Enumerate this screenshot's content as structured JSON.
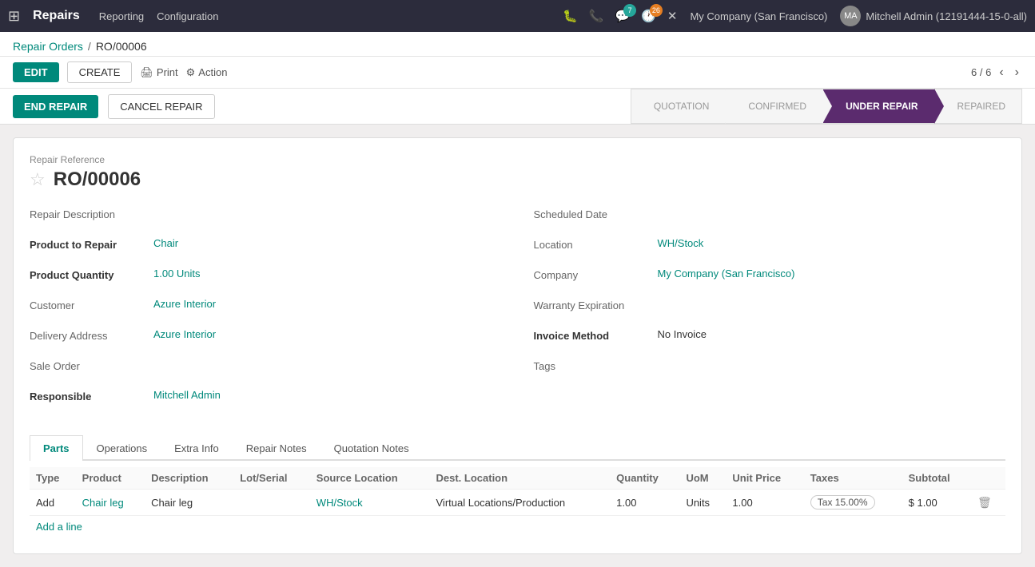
{
  "app": {
    "name": "Repairs",
    "nav_links": [
      "Reporting",
      "Configuration"
    ]
  },
  "topbar": {
    "icons": {
      "bug": "🐛",
      "phone": "📞",
      "chat_badge": "7",
      "clock_badge": "26",
      "wrench": "🔧"
    },
    "company": "My Company (San Francisco)",
    "user": "Mitchell Admin (12191444-15-0-all)"
  },
  "breadcrumb": {
    "parent": "Repair Orders",
    "separator": "/",
    "current": "RO/00006"
  },
  "toolbar": {
    "edit_label": "EDIT",
    "create_label": "CREATE",
    "print_label": "Print",
    "action_label": "Action",
    "pagination": "6 / 6"
  },
  "status_bar": {
    "end_repair_label": "END REPAIR",
    "cancel_repair_label": "CANCEL REPAIR",
    "steps": [
      "QUOTATION",
      "CONFIRMED",
      "UNDER REPAIR",
      "REPAIRED"
    ],
    "active_step": "UNDER REPAIR"
  },
  "form": {
    "repair_ref_label": "Repair Reference",
    "repair_ref_id": "RO/00006",
    "fields_left": [
      {
        "label": "Repair Description",
        "value": "",
        "is_bold": false,
        "is_link": false
      },
      {
        "label": "Product to Repair",
        "value": "Chair",
        "is_bold": true,
        "is_link": true
      },
      {
        "label": "Product Quantity",
        "value": "1.00 Units",
        "is_bold": true,
        "is_link": true
      },
      {
        "label": "Customer",
        "value": "Azure Interior",
        "is_bold": false,
        "is_link": true
      },
      {
        "label": "Delivery Address",
        "value": "Azure Interior",
        "is_bold": false,
        "is_link": true
      },
      {
        "label": "Sale Order",
        "value": "",
        "is_bold": false,
        "is_link": false
      },
      {
        "label": "Responsible",
        "value": "Mitchell Admin",
        "is_bold": false,
        "is_link": true
      }
    ],
    "fields_right": [
      {
        "label": "Scheduled Date",
        "value": "",
        "is_bold": false,
        "is_link": false
      },
      {
        "label": "Location",
        "value": "WH/Stock",
        "is_bold": false,
        "is_link": true
      },
      {
        "label": "Company",
        "value": "My Company (San Francisco)",
        "is_bold": false,
        "is_link": true
      },
      {
        "label": "Warranty Expiration",
        "value": "",
        "is_bold": false,
        "is_link": false
      },
      {
        "label": "Invoice Method",
        "value": "No Invoice",
        "is_bold": false,
        "is_link": false
      },
      {
        "label": "Tags",
        "value": "",
        "is_bold": false,
        "is_link": false
      }
    ]
  },
  "tabs": [
    "Parts",
    "Operations",
    "Extra Info",
    "Repair Notes",
    "Quotation Notes"
  ],
  "active_tab": "Parts",
  "parts_table": {
    "columns": [
      "Type",
      "Product",
      "Description",
      "Lot/Serial",
      "Source Location",
      "Dest. Location",
      "Quantity",
      "UoM",
      "Unit Price",
      "Taxes",
      "Subtotal"
    ],
    "rows": [
      {
        "type": "Add",
        "product": "Chair leg",
        "description": "Chair leg",
        "lot_serial": "",
        "source_location": "WH/Stock",
        "dest_location": "Virtual Locations/Production",
        "quantity": "1.00",
        "uom": "Units",
        "unit_price": "1.00",
        "taxes": "Tax 15.00%",
        "subtotal": "$ 1.00"
      }
    ],
    "add_line_label": "Add a line"
  }
}
